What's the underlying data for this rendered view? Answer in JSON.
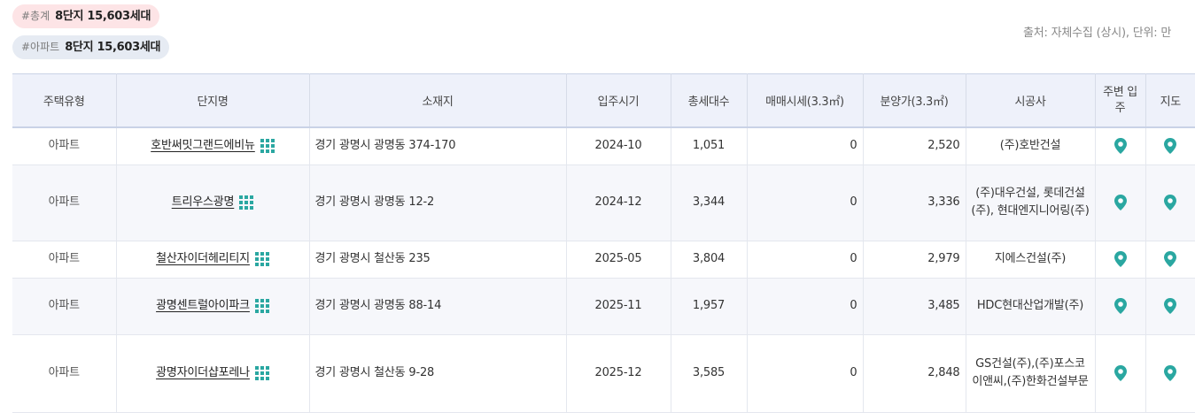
{
  "summary": {
    "total": {
      "tag": "#총계",
      "value": "8단지 15,603세대"
    },
    "apartment": {
      "tag": "#아파트",
      "value": "8단지 15,603세대"
    }
  },
  "source_text": "출처: 자체수집 (상시), 단위: 만",
  "table": {
    "headers": {
      "type": "주택유형",
      "name": "단지명",
      "address": "소재지",
      "move_in": "입주시기",
      "households": "총세대수",
      "sale_price": "매매시세(3.3㎡)",
      "presale_price": "분양가(3.3㎡)",
      "builder": "시공사",
      "nearby": "주변 입주",
      "map": "지도"
    },
    "rows": [
      {
        "type": "아파트",
        "name": "호반써밋그랜드에비뉴",
        "address": "경기 광명시 광명동 374-170",
        "move_in": "2024-10",
        "households": "1,051",
        "sale_price": "0",
        "presale_price": "2,520",
        "builder": "(주)호반건설"
      },
      {
        "type": "아파트",
        "name": "트리우스광명",
        "address": "경기 광명시 광명동 12-2",
        "move_in": "2024-12",
        "households": "3,344",
        "sale_price": "0",
        "presale_price": "3,336",
        "builder": "(주)대우건설, 롯데건설(주), 현대엔지니어링(주)"
      },
      {
        "type": "아파트",
        "name": "철산자이더헤리티지",
        "address": "경기 광명시 철산동 235",
        "move_in": "2025-05",
        "households": "3,804",
        "sale_price": "0",
        "presale_price": "2,979",
        "builder": "지에스건설(주)"
      },
      {
        "type": "아파트",
        "name": "광명센트럴아이파크",
        "address": "경기 광명시 광명동 88-14",
        "move_in": "2025-11",
        "households": "1,957",
        "sale_price": "0",
        "presale_price": "3,485",
        "builder": "HDC현대산업개발(주)"
      },
      {
        "type": "아파트",
        "name": "광명자이더샵포레나",
        "address": "경기 광명시 철산동 9-28",
        "move_in": "2025-12",
        "households": "3,585",
        "sale_price": "0",
        "presale_price": "2,848",
        "builder": "GS건설(주),(주)포스코이앤씨,(주)한화건설부문"
      }
    ]
  },
  "colors": {
    "accent": "#2aa7a1",
    "header_bg": "#eef1fa",
    "badge_total_bg": "#fde4e6",
    "badge_apt_bg": "#e6ebf3"
  },
  "icons": {
    "complex_info": "grid-dots-icon",
    "nearby": "map-pin-icon",
    "map": "map-pin-icon"
  }
}
